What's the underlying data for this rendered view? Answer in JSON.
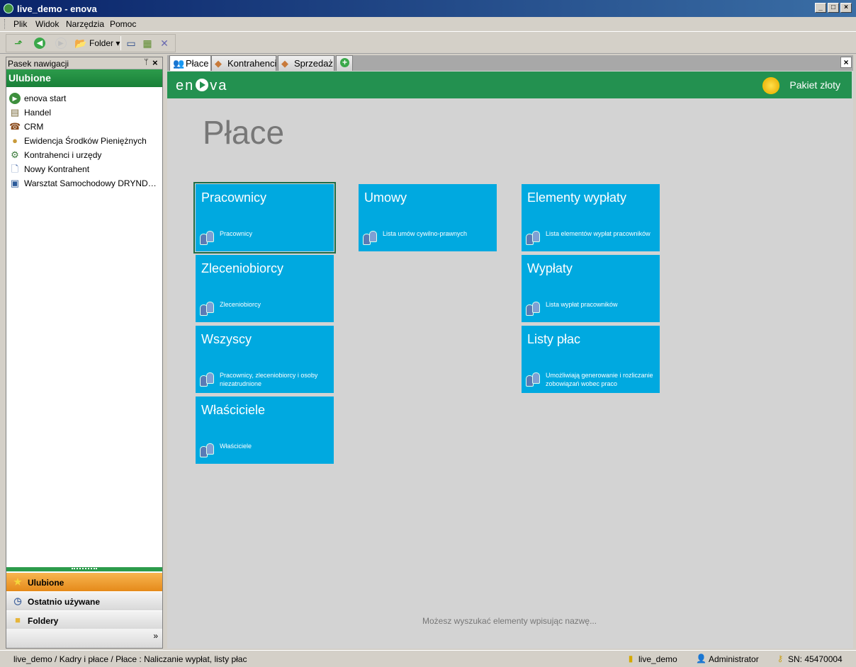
{
  "window": {
    "title": "live_demo - enova",
    "min": "_",
    "max": "□",
    "close": "×"
  },
  "menu": [
    "Plik",
    "Widok",
    "Narzędzia",
    "Pomoc"
  ],
  "toolbar": {
    "folder_label": "Folder ▾"
  },
  "nav": {
    "header": "Pasek nawigacji",
    "pin": "ᛘ",
    "close": "×",
    "title": "Ulubione",
    "items": [
      {
        "label": "enova start",
        "icon": "enova-icon"
      },
      {
        "label": "Handel",
        "icon": "handel-icon"
      },
      {
        "label": "CRM",
        "icon": "phone-icon"
      },
      {
        "label": "Ewidencja Środków Pieniężnych",
        "icon": "coins-icon"
      },
      {
        "label": "Kontrahenci i urzędy",
        "icon": "contacts-icon"
      },
      {
        "label": "Nowy Kontrahent",
        "icon": "document-icon"
      },
      {
        "label": "Warsztat Samochodowy DRYNDA Wi...",
        "icon": "workshop-icon"
      }
    ],
    "sections": [
      "Ulubione",
      "Ostatnio używane",
      "Foldery"
    ],
    "more": "»"
  },
  "tabs": [
    "Płace",
    "Kontrahenci",
    "Sprzedaż"
  ],
  "tab_add": "+",
  "tab_close": "×",
  "brand": {
    "logo_left": "en",
    "logo_right": "va",
    "package": "Pakiet złoty"
  },
  "page_title": "Płace",
  "tiles": [
    {
      "title": "Pracownicy",
      "desc": "Pracownicy"
    },
    {
      "title": "Zleceniobiorcy",
      "desc": "Zleceniobiorcy"
    },
    {
      "title": "Wszyscy",
      "desc": "Pracownicy, zleceniobiorcy i osoby niezatrudnione"
    },
    {
      "title": "Właściciele",
      "desc": "Właściciele"
    },
    {
      "title": "Umowy",
      "desc": "Lista umów cywilno-prawnych"
    },
    {
      "title": "Elementy wypłaty",
      "desc": "Lista elementów wypłat pracowników"
    },
    {
      "title": "Wypłaty",
      "desc": "Lista wypłat pracowników"
    },
    {
      "title": "Listy płac",
      "desc": "Umożliwiają generowanie i rozliczanie zobowiązań wobec praco"
    }
  ],
  "hint": "Możesz wyszukać elementy wpisując nazwę...",
  "status": {
    "path": "live_demo / Kadry i płace / Płace : Naliczanie wypłat, listy płac",
    "db": "live_demo",
    "user": "Administrator",
    "serial": "SN: 45470004"
  },
  "colors": {
    "tile": "#00a9e0",
    "brand": "#239150",
    "active_section": "#f0a030"
  }
}
